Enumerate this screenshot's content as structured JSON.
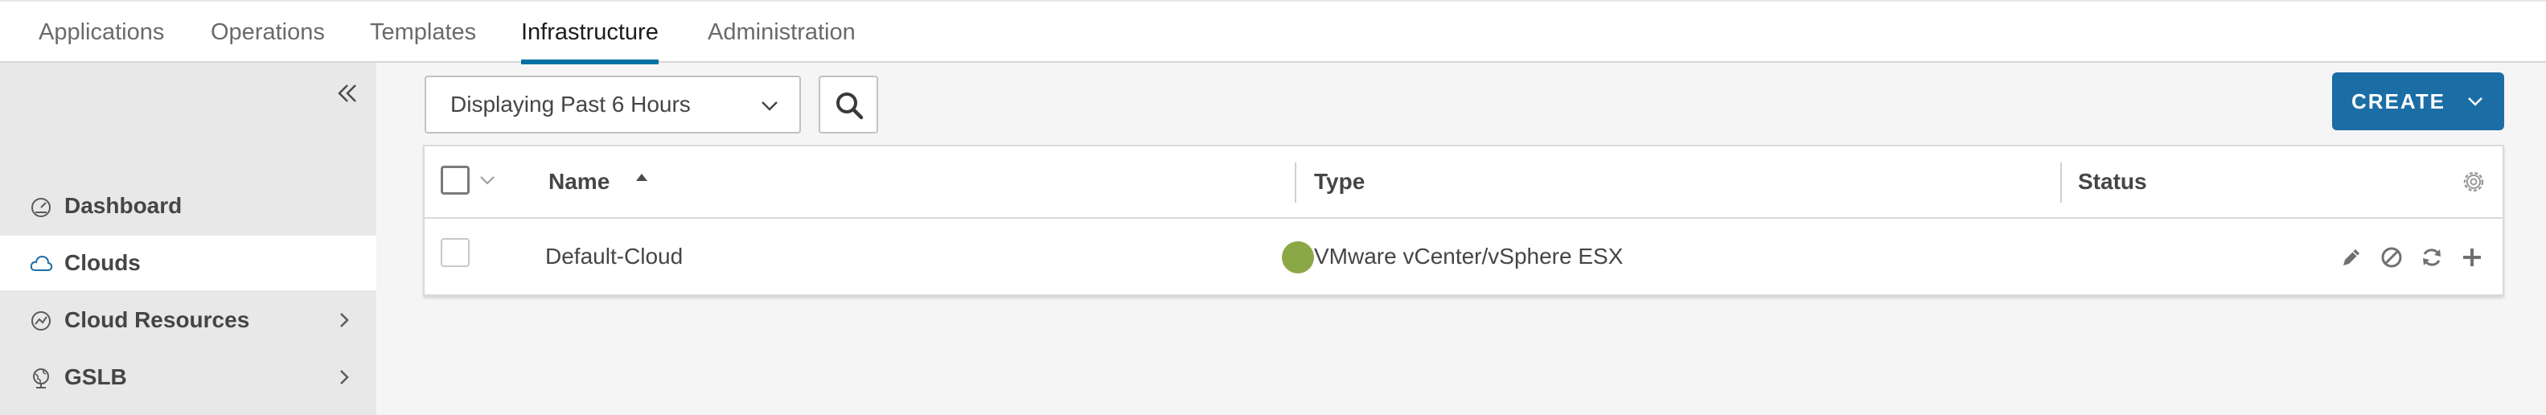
{
  "nav": {
    "tabs": [
      {
        "label": "Applications"
      },
      {
        "label": "Operations"
      },
      {
        "label": "Templates"
      },
      {
        "label": "Infrastructure"
      },
      {
        "label": "Administration"
      }
    ],
    "active_tab": "Infrastructure",
    "accent_color": "#0072a3"
  },
  "sidebar": {
    "collapse_icon": "double-chevron-left-icon",
    "items": [
      {
        "label": "Dashboard",
        "icon": "dashboard-icon",
        "selected": false,
        "expandable": false
      },
      {
        "label": "Clouds",
        "icon": "cloud-icon",
        "selected": true,
        "expandable": false
      },
      {
        "label": "Cloud Resources",
        "icon": "cloud-resources-icon",
        "selected": false,
        "expandable": true
      },
      {
        "label": "GSLB",
        "icon": "globe-icon",
        "selected": false,
        "expandable": true
      }
    ]
  },
  "toolbar": {
    "time_range": "Displaying Past 6 Hours",
    "search_icon": "search-icon",
    "create_label": "CREATE",
    "create_color": "#1b6ea5"
  },
  "table": {
    "columns": [
      {
        "label": "Name",
        "sorted": "ascending"
      },
      {
        "label": "Type"
      },
      {
        "label": "Status"
      }
    ],
    "rows": [
      {
        "name": "Default-Cloud",
        "type": "VMware vCenter/vSphere ESX",
        "status": "up",
        "status_color": "#8aa846",
        "actions": [
          "edit-icon",
          "disable-icon",
          "refresh-icon",
          "add-icon"
        ]
      }
    ]
  }
}
